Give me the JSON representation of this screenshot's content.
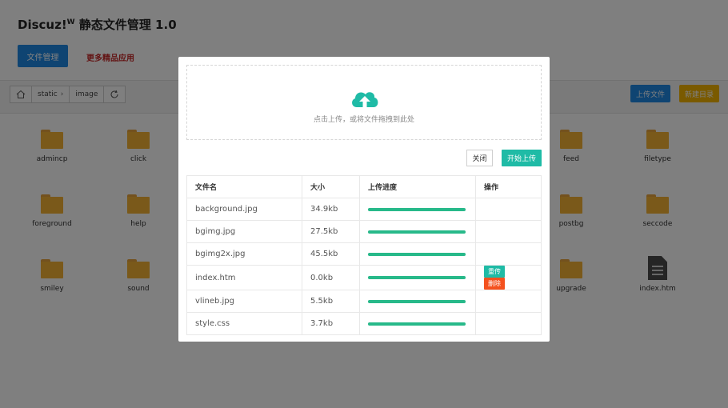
{
  "app": {
    "title_main": "Discuz!",
    "title_sup": "W",
    "title_rest": " 静态文件管理 1.0",
    "nav_files": "文件管理",
    "nav_more": "更多精品应用"
  },
  "toolbar": {
    "breadcrumbs": [
      "static",
      "image"
    ],
    "upload_label": "上传文件",
    "newdir_label": "新建目录"
  },
  "grid": {
    "row1": [
      "admincp",
      "click",
      "feed",
      "filetype"
    ],
    "row2": [
      "foreground",
      "help",
      "postbg",
      "seccode"
    ],
    "row3": [
      "smiley",
      "sound",
      "upgrade",
      "index.htm"
    ]
  },
  "modal": {
    "drop_text": "点击上传，或将文件拖拽到此处",
    "close_label": "关闭",
    "start_label": "开始上传",
    "columns": [
      "文件名",
      "大小",
      "上传进度",
      "操作"
    ],
    "files": [
      {
        "name": "background.jpg",
        "size": "34.9kb",
        "progress": 1.0
      },
      {
        "name": "bgimg.jpg",
        "size": "27.5kb",
        "progress": 1.0
      },
      {
        "name": "bgimg2x.jpg",
        "size": "45.5kb",
        "progress": 1.0
      },
      {
        "name": "index.htm",
        "size": "0.0kb",
        "progress": 1.0,
        "actions": [
          "重传",
          "删除"
        ]
      },
      {
        "name": "vlineb.jpg",
        "size": "5.5kb",
        "progress": 1.0
      },
      {
        "name": "style.css",
        "size": "3.7kb",
        "progress": 1.0
      }
    ]
  },
  "colors": {
    "primary": "#1e88e5",
    "warning": "#f4b400",
    "teal": "#1fbba6",
    "danger": "#f4511e",
    "progress": "#27b98a",
    "folder": "#f5b335"
  },
  "icons": {
    "home": "home-icon",
    "refresh": "refresh-icon",
    "cloud": "cloud-upload-icon",
    "folder": "folder-icon",
    "file": "file-icon"
  }
}
